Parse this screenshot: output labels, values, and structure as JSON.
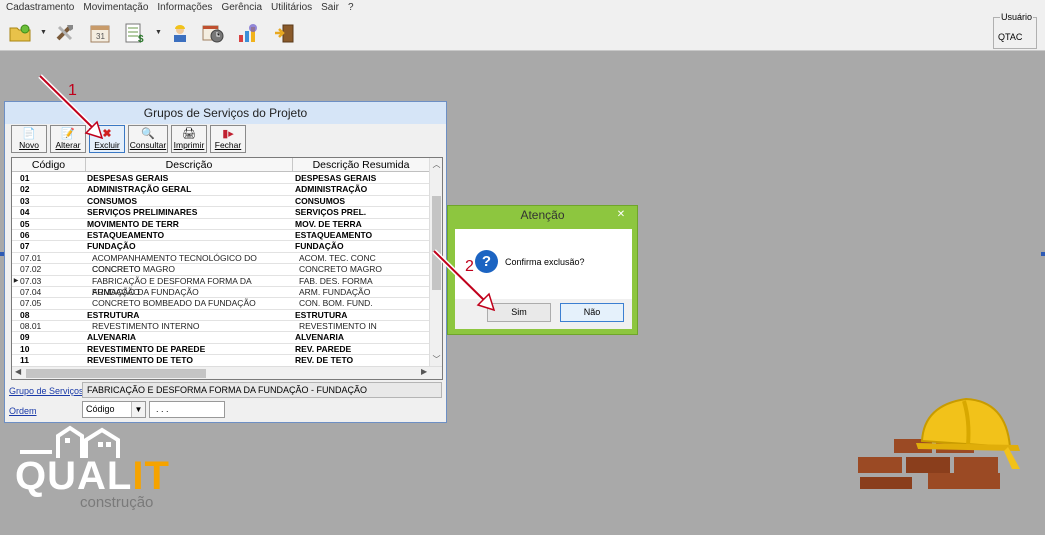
{
  "menu": {
    "items": [
      "Cadastramento",
      "Movimentação",
      "Informações",
      "Gerência",
      "Utilitários",
      "Sair",
      "?"
    ]
  },
  "toolbar": {
    "icons": [
      "folder-icon",
      "tools-icon",
      "calendar-icon",
      "spreadsheet-money-icon",
      "worker-icon",
      "calendar-clock-icon",
      "chart-icon",
      "exit-door-icon"
    ]
  },
  "user": {
    "label": "Usuário",
    "value": "QTAC"
  },
  "window": {
    "title": "Grupos de Serviços do Projeto",
    "buttons": {
      "novo": "Novo",
      "alterar": "Alterar",
      "excluir": "Excluir",
      "consultar": "Consultar",
      "imprimir": "Imprimir",
      "fechar": "Fechar"
    },
    "columns": [
      "Código",
      "Descrição",
      "Descrição Resumida"
    ],
    "rows": [
      {
        "code": "01",
        "desc": "DESPESAS GERAIS",
        "short": "DESPESAS GERAIS",
        "bold": true
      },
      {
        "code": "02",
        "desc": "ADMINISTRAÇÃO GERAL",
        "short": "ADMINISTRAÇÃO",
        "bold": true
      },
      {
        "code": "03",
        "desc": "CONSUMOS",
        "short": "CONSUMOS",
        "bold": true
      },
      {
        "code": "04",
        "desc": "SERVIÇOS PRELIMINARES",
        "short": "SERVIÇOS PREL.",
        "bold": true
      },
      {
        "code": "05",
        "desc": "MOVIMENTO DE TERR",
        "short": "MOV. DE TERRA",
        "bold": true
      },
      {
        "code": "06",
        "desc": "ESTAQUEAMENTO",
        "short": "ESTAQUEAMENTO",
        "bold": true
      },
      {
        "code": "07",
        "desc": "FUNDAÇÃO",
        "short": "FUNDAÇÃO",
        "bold": true
      },
      {
        "code": "07.01",
        "desc": "ACOMPANHAMENTO TECNOLÓGICO DO CONCRETO",
        "short": "ACOM. TEC. CONC",
        "bold": false
      },
      {
        "code": "07.02",
        "desc": "CONCRETO MAGRO",
        "short": "CONCRETO MAGRO",
        "bold": false
      },
      {
        "code": "07.03",
        "desc": "FABRICAÇÃO E DESFORMA FORMA DA FUNDAÇÃO",
        "short": "FAB. DES. FORMA",
        "bold": false,
        "selected": true
      },
      {
        "code": "07.04",
        "desc": "ARMAÇÃO DA FUNDAÇÃO",
        "short": "ARM. FUNDAÇÃO",
        "bold": false
      },
      {
        "code": "07.05",
        "desc": "CONCRETO BOMBEADO DA FUNDAÇÃO",
        "short": "CON. BOM. FUND.",
        "bold": false
      },
      {
        "code": "08",
        "desc": "ESTRUTURA",
        "short": "ESTRUTURA",
        "bold": true
      },
      {
        "code": "08.01",
        "desc": "REVESTIMENTO INTERNO",
        "short": "REVESTIMENTO IN",
        "bold": false
      },
      {
        "code": "09",
        "desc": "ALVENARIA",
        "short": "ALVENARIA",
        "bold": true
      },
      {
        "code": "10",
        "desc": "REVESTIMENTO DE PAREDE",
        "short": "REV. PAREDE",
        "bold": true
      },
      {
        "code": "11",
        "desc": "REVESTIMENTO DE TETO",
        "short": "REV. DE TETO",
        "bold": true
      }
    ],
    "grupo_label": "Grupo de Serviços",
    "grupo_value": "FABRICAÇÃO E DESFORMA FORMA DA FUNDAÇÃO - FUNDAÇÃO",
    "ordem_label": "Ordem",
    "ordem_value": "Código",
    "ordem_input": ". . ."
  },
  "dialog": {
    "title": "Atenção",
    "message": "Confirma exclusão?",
    "yes": "Sim",
    "no": "Não"
  },
  "annotations": {
    "step1": "1",
    "step2": "2"
  },
  "logo": {
    "main_a": "QUAL",
    "main_b": "IT",
    "sub": "construção"
  },
  "colors": {
    "desktop": "#a9a9a9",
    "dialog_frame": "#8dc63f",
    "annotation": "#c0001b",
    "logo_accent": "#f5a300"
  }
}
